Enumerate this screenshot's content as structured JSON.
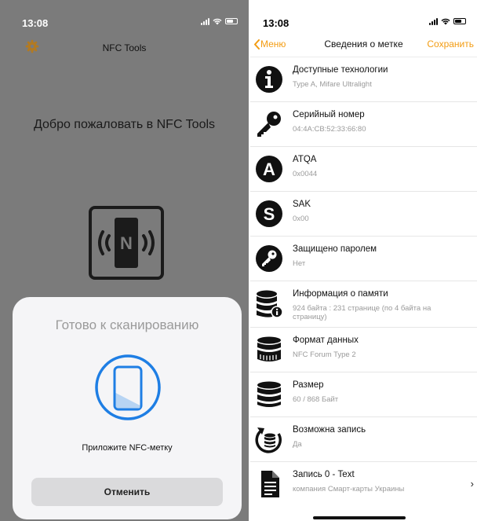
{
  "left": {
    "status_time": "13:08",
    "nav_title": "NFC Tools",
    "welcome": "Добро пожаловать в NFC Tools",
    "nfc_glyph": "N",
    "sheet": {
      "title": "Готово к сканированию",
      "hint": "Приложите NFC-метку",
      "cancel_label": "Отменить"
    }
  },
  "right": {
    "status_time": "13:08",
    "nav": {
      "back_label": "Меню",
      "title": "Сведения о метке",
      "save_label": "Сохранить"
    },
    "rows": [
      {
        "icon": "info-icon",
        "title": "Доступные технологии",
        "sub": "Type A, Mifare Ultralight"
      },
      {
        "icon": "key-icon",
        "title": "Серийный номер",
        "sub": "04:4A:CB:52:33:66:80"
      },
      {
        "icon": "letter-a-icon",
        "title": "ATQA",
        "sub": "0x0044"
      },
      {
        "icon": "letter-s-icon",
        "title": "SAK",
        "sub": "0x00"
      },
      {
        "icon": "key-circle-icon",
        "title": "Защищено паролем",
        "sub": "Нет"
      },
      {
        "icon": "database-info-icon",
        "title": "Информация о памяти",
        "sub": "924 байта : 231 странице (по 4 байта на страницу)"
      },
      {
        "icon": "database-format-icon",
        "title": "Формат данных",
        "sub": "NFC Forum Type 2"
      },
      {
        "icon": "database-icon",
        "title": "Размер",
        "sub": "60 / 868 Байт"
      },
      {
        "icon": "rewrite-icon",
        "title": "Возможна запись",
        "sub": "Да"
      },
      {
        "icon": "document-icon",
        "title": "Запись 0 - Text",
        "sub": "компания Смарт-карты Украины"
      }
    ]
  },
  "colors": {
    "accent": "#f39c12",
    "scan_blue": "#1e7ee4",
    "dim_overlay": "#7b7b7b"
  }
}
